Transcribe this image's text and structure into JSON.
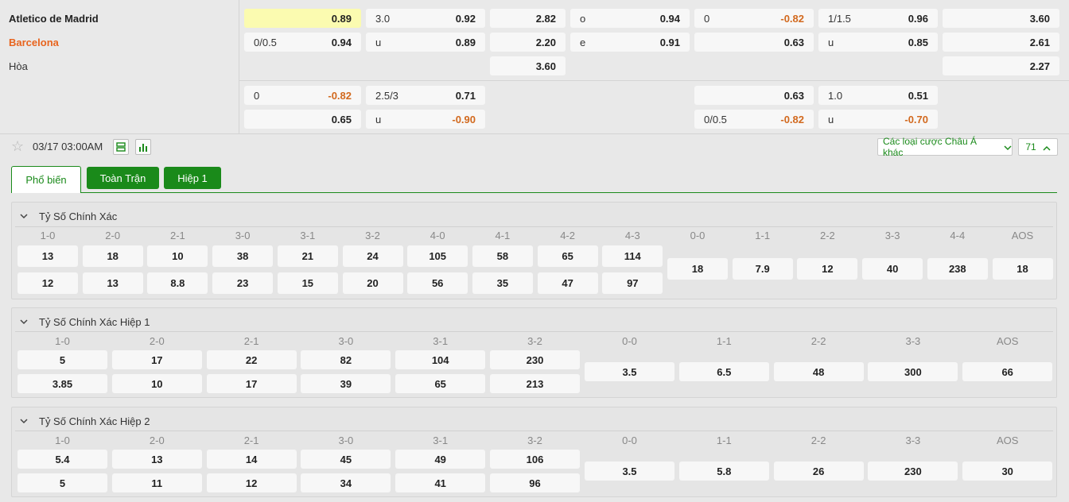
{
  "teams": {
    "home": "Atletico de Madrid",
    "away": "Barcelona",
    "draw": "Hòa"
  },
  "odds_rows": [
    [
      {
        "l": "",
        "r": "0.89",
        "hl": true
      },
      {
        "l": "3.0",
        "r": "0.92"
      },
      {
        "l": "",
        "r": "2.82"
      },
      {
        "l": "o",
        "r": "0.94"
      },
      {
        "l": "0",
        "r": "-0.82",
        "neg": true
      },
      {
        "l": "1/1.5",
        "r": "0.96"
      },
      {
        "l": "",
        "r": "3.60"
      }
    ],
    [
      {
        "l": "0/0.5",
        "r": "0.94"
      },
      {
        "l": "u",
        "r": "0.89"
      },
      {
        "l": "",
        "r": "2.20"
      },
      {
        "l": "e",
        "r": "0.91"
      },
      {
        "l": "",
        "r": "0.63"
      },
      {
        "l": "u",
        "r": "0.85"
      },
      {
        "l": "",
        "r": "2.61"
      }
    ],
    [
      {
        "l": "",
        "r": "3.60"
      },
      {
        "l": "",
        "r": "2.27"
      }
    ],
    [
      {
        "l": "0",
        "r": "-0.82",
        "neg": true
      },
      {
        "l": "2.5/3",
        "r": "0.71"
      },
      {
        "l": "",
        "r": "0.63"
      },
      {
        "l": "1.0",
        "r": "0.51"
      }
    ],
    [
      {
        "l": "",
        "r": "0.65"
      },
      {
        "l": "u",
        "r": "-0.90",
        "neg": true
      },
      {
        "l": "0/0.5",
        "r": "-0.82",
        "neg": true
      },
      {
        "l": "u",
        "r": "-0.70",
        "neg": true
      }
    ]
  ],
  "match": {
    "datetime": "03/17 03:00AM",
    "dropdown": "Các loại cược Châu Á khác",
    "count": "71"
  },
  "tabs": [
    "Phổ biến",
    "Toàn Trận",
    "Hiệp 1"
  ],
  "sections": [
    {
      "title": "Tỷ Số Chính Xác",
      "a_labels": [
        "1-0",
        "2-0",
        "2-1",
        "3-0",
        "3-1",
        "3-2",
        "4-0",
        "4-1",
        "4-2",
        "4-3"
      ],
      "a_row1": [
        "13",
        "18",
        "10",
        "38",
        "21",
        "24",
        "105",
        "58",
        "65",
        "114"
      ],
      "a_row2": [
        "12",
        "13",
        "8.8",
        "23",
        "15",
        "20",
        "56",
        "35",
        "47",
        "97"
      ],
      "d_labels": [
        "0-0",
        "1-1",
        "2-2",
        "3-3",
        "4-4",
        "AOS"
      ],
      "d_vals": [
        "18",
        "7.9",
        "12",
        "40",
        "238",
        "18"
      ]
    },
    {
      "title": "Tỷ Số Chính Xác Hiệp 1",
      "a_labels": [
        "1-0",
        "2-0",
        "2-1",
        "3-0",
        "3-1",
        "3-2"
      ],
      "a_row1": [
        "5",
        "17",
        "22",
        "82",
        "104",
        "230"
      ],
      "a_row2": [
        "3.85",
        "10",
        "17",
        "39",
        "65",
        "213"
      ],
      "d_labels": [
        "0-0",
        "1-1",
        "2-2",
        "3-3",
        "AOS"
      ],
      "d_vals": [
        "3.5",
        "6.5",
        "48",
        "300",
        "66"
      ]
    },
    {
      "title": "Tỷ Số Chính Xác Hiệp 2",
      "a_labels": [
        "1-0",
        "2-0",
        "2-1",
        "3-0",
        "3-1",
        "3-2"
      ],
      "a_row1": [
        "5.4",
        "13",
        "14",
        "45",
        "49",
        "106"
      ],
      "a_row2": [
        "5",
        "11",
        "12",
        "34",
        "41",
        "96"
      ],
      "d_labels": [
        "0-0",
        "1-1",
        "2-2",
        "3-3",
        "AOS"
      ],
      "d_vals": [
        "3.5",
        "5.8",
        "26",
        "230",
        "30"
      ]
    }
  ],
  "colors": {
    "accent_green": "#1a8a1a",
    "tab_active_bg": "#ffffff",
    "negative": "#d2691e",
    "highlight": "#fbfbb0"
  },
  "icons": {
    "favorite": "star-icon",
    "stats1": "list-icon",
    "stats2": "bar-chart-icon",
    "dropdown": "chevron-down-icon",
    "collapse": "chevron-up-icon"
  }
}
